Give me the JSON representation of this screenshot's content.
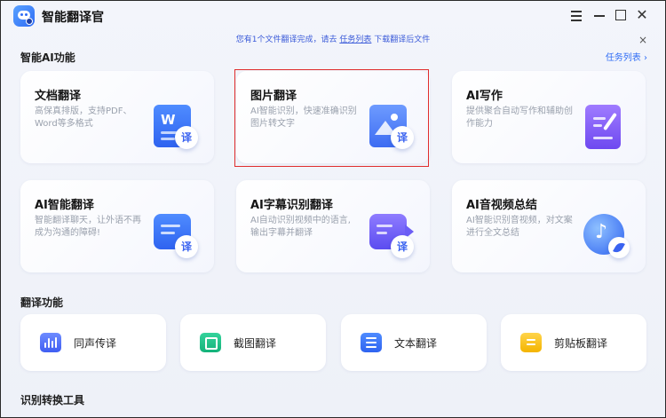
{
  "app": {
    "title": "智能翻译官"
  },
  "notice": {
    "prefix": "您有1个文件翻译完成，请去",
    "link": "任务列表",
    "suffix": "下载翻译后文件",
    "close": "×"
  },
  "window_controls": {
    "close": "✕"
  },
  "sections": {
    "ai": "智能AI功能",
    "translate": "翻译功能",
    "convert": "识别转换工具"
  },
  "task_list_link": "任务列表 ›",
  "cards": [
    {
      "title": "文档翻译",
      "desc": "高保真排版，支持PDF、Word等多格式",
      "icon": "document-translate-icon",
      "badge": "译",
      "glyph": "W"
    },
    {
      "title": "图片翻译",
      "desc": "AI智能识别，快速准确识别图片转文字",
      "icon": "image-translate-icon",
      "badge": "译"
    },
    {
      "title": "AI写作",
      "desc": "提供聚合自动写作和辅助创作能力",
      "icon": "ai-writing-icon"
    },
    {
      "title": "AI智能翻译",
      "desc": "智能翻译聊天，让外语不再成为沟通的障碍!",
      "icon": "ai-chat-translate-icon",
      "badge": "译"
    },
    {
      "title": "AI字幕识别翻译",
      "desc": "AI自动识别视频中的语言,输出字幕并翻译",
      "icon": "subtitle-translate-icon",
      "badge": "译"
    },
    {
      "title": "AI音视频总结",
      "desc": "AI智能识别音视频，对文案进行全文总结",
      "icon": "av-summary-icon"
    }
  ],
  "tools": [
    {
      "label": "同声传译",
      "icon": "voice-wave-icon"
    },
    {
      "label": "截图翻译",
      "icon": "screenshot-icon"
    },
    {
      "label": "文本翻译",
      "icon": "text-list-icon"
    },
    {
      "label": "剪贴板翻译",
      "icon": "clipboard-icon"
    }
  ],
  "colors": {
    "accent": "#2f6cf5",
    "selected_outline": "#e02d2d"
  }
}
